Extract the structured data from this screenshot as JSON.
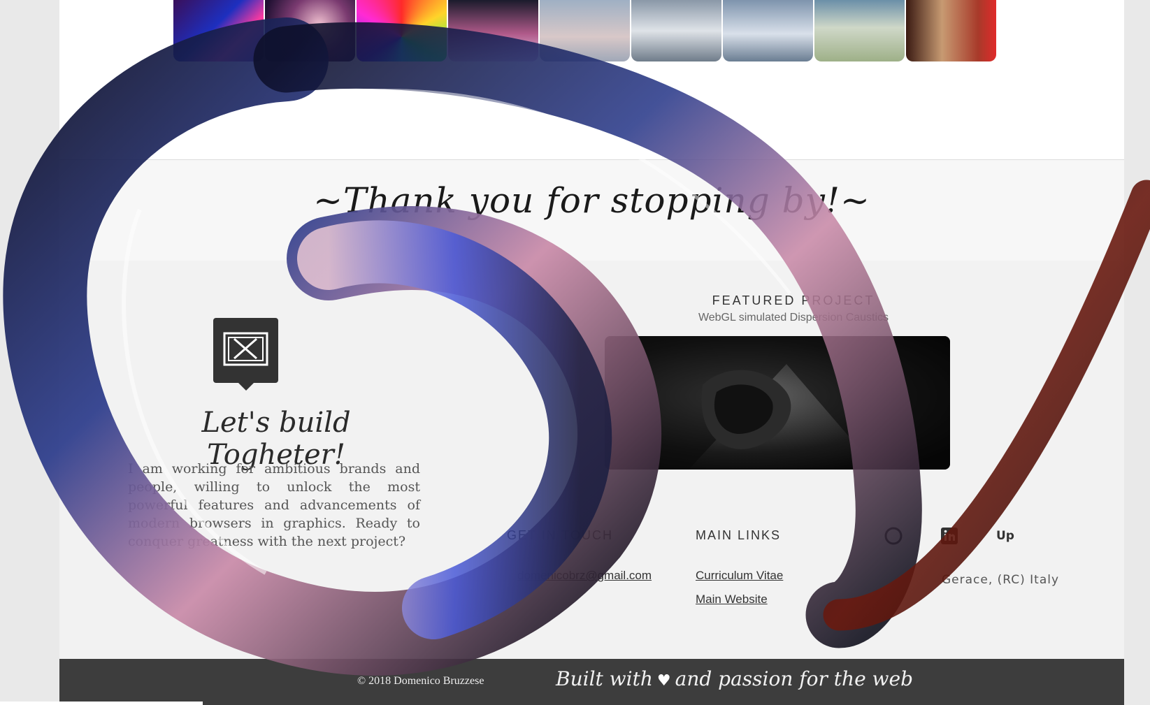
{
  "thumbnails": [
    {
      "name": "thumb-neon-lines"
    },
    {
      "name": "thumb-bokeh-lights"
    },
    {
      "name": "thumb-color-wheel"
    },
    {
      "name": "thumb-figures-pink"
    },
    {
      "name": "thumb-dragon-grey"
    },
    {
      "name": "thumb-jet-1"
    },
    {
      "name": "thumb-jet-2"
    },
    {
      "name": "thumb-statue-green"
    },
    {
      "name": "thumb-red-room"
    }
  ],
  "thanks_text": "~Thank you for stopping by!~",
  "build": {
    "title": "Let's build Togheter!",
    "text": "I am working for ambitious brands and people, willing to unlock the most powerful features and advancements of modern browsers in graphics. Ready to conquer greatness with the next project?"
  },
  "featured": {
    "title": "FEATURED PROJECT",
    "subtitle": "WebGL simulated Dispersion Caustics"
  },
  "contact": {
    "heading": "GET IN TOUCH",
    "email": "domenicobrz@gmail.com"
  },
  "main_links": {
    "heading": "MAIN LINKS",
    "links": [
      "Curriculum Vitae",
      "Main Website"
    ]
  },
  "social": {
    "icons": [
      "github-icon",
      "linkedin-icon",
      "upwork-icon"
    ],
    "location": "Gerace, (RC) Italy"
  },
  "footer": {
    "copyright": "© 2018 Domenico Bruzzese",
    "built_prefix": "Built with",
    "built_suffix": "and passion for the web"
  },
  "colors": {
    "footer_bg": "#3d3d3d",
    "band_bg": "#f7f7f7",
    "main_bg": "#f2f2f2"
  }
}
